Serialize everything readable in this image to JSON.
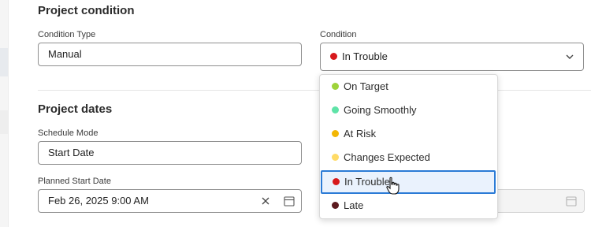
{
  "project_condition": {
    "title": "Project condition",
    "condition_type": {
      "label": "Condition Type",
      "value": "Manual"
    },
    "condition": {
      "label": "Condition",
      "value": "In Trouble",
      "color": "#d7191c"
    }
  },
  "project_dates": {
    "title": "Project dates",
    "schedule_mode": {
      "label": "Schedule Mode",
      "value": "Start Date"
    },
    "planned_start": {
      "label": "Planned Start Date",
      "value": "Feb 26, 2025 9:00 AM"
    }
  },
  "dropdown": {
    "options": [
      {
        "label": "On Target",
        "color": "#9ed33a"
      },
      {
        "label": "Going Smoothly",
        "color": "#5fe3a8"
      },
      {
        "label": "At Risk",
        "color": "#f2b705"
      },
      {
        "label": "Changes Expected",
        "color": "#ffdb66"
      },
      {
        "label": "In Trouble",
        "color": "#d7191c",
        "highlighted": true
      },
      {
        "label": "Late",
        "color": "#5c1a1f"
      }
    ]
  },
  "icons": {
    "clear": "close-icon",
    "calendar": "calendar-icon",
    "chevron": "chevron-down-icon",
    "cursor": "hand-pointer-icon"
  }
}
